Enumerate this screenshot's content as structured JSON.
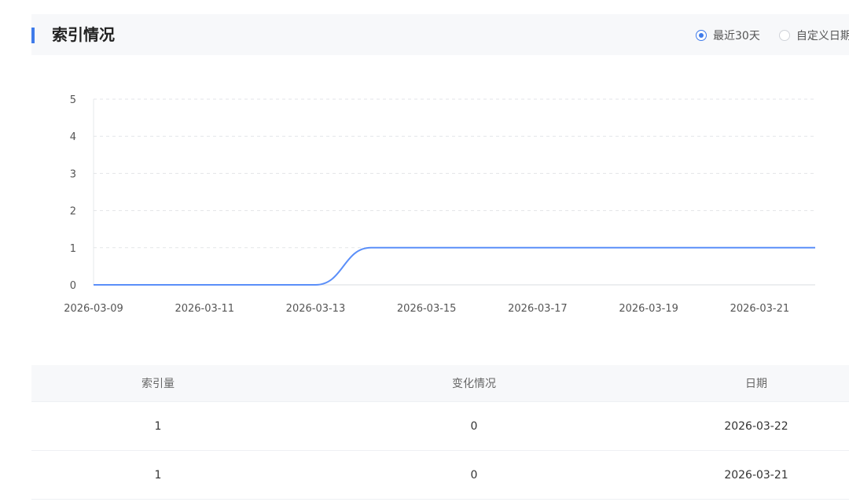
{
  "header": {
    "title": "索引情况",
    "options": [
      {
        "label": "最近30天",
        "checked": true
      },
      {
        "label": "自定义日期",
        "checked": false
      }
    ]
  },
  "colors": {
    "accent": "#3f7bea",
    "line": "#5b8ff9"
  },
  "chart_data": {
    "type": "line",
    "x": [
      "2026-03-09",
      "2026-03-10",
      "2026-03-11",
      "2026-03-12",
      "2026-03-13",
      "2026-03-14",
      "2026-03-15",
      "2026-03-16",
      "2026-03-17",
      "2026-03-18",
      "2026-03-19",
      "2026-03-20",
      "2026-03-21",
      "2026-03-22"
    ],
    "x_tick_labels": [
      "2026-03-09",
      "2026-03-11",
      "2026-03-13",
      "2026-03-15",
      "2026-03-17",
      "2026-03-19",
      "2026-03-21"
    ],
    "series": [
      {
        "values": [
          0,
          0,
          0,
          0,
          0,
          1,
          1,
          1,
          1,
          1,
          1,
          1,
          1,
          1
        ]
      }
    ],
    "ylim": [
      0,
      5
    ],
    "y_ticks": [
      0,
      1,
      2,
      3,
      4,
      5
    ],
    "grid": true,
    "smooth": true
  },
  "table": {
    "headers": [
      "索引量",
      "变化情况",
      "日期"
    ],
    "rows": [
      [
        "1",
        "0",
        "2026-03-22"
      ],
      [
        "1",
        "0",
        "2026-03-21"
      ]
    ]
  }
}
